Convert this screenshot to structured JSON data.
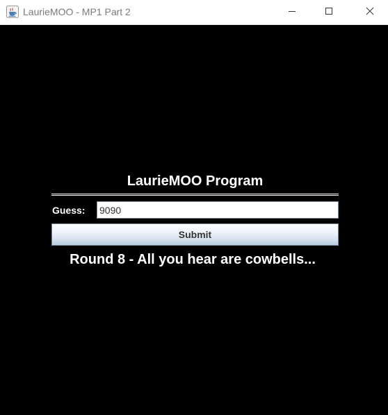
{
  "window": {
    "title": "LaurieMOO - MP1 Part 2",
    "app_icon": "java-cup-icon",
    "controls": {
      "minimize_icon": "minimize-icon",
      "maximize_icon": "maximize-icon",
      "close_icon": "close-icon"
    }
  },
  "main": {
    "program_title": "LaurieMOO Program",
    "guess_label": "Guess:",
    "guess_value": "9090",
    "submit_label": "Submit",
    "status_message": "Round 8 - All you hear are cowbells..."
  },
  "colors": {
    "background": "#000000",
    "text": "#ffffff",
    "titlebar": "#ffffff",
    "button_gradient_top": "#ffffff",
    "button_gradient_bottom": "#b8cce2"
  }
}
